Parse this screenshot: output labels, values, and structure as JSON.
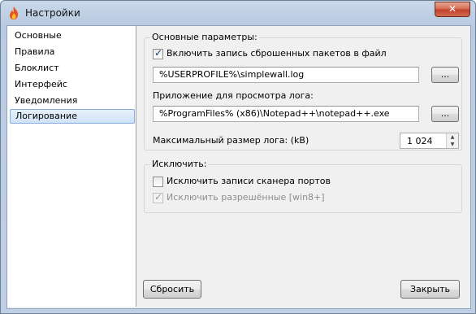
{
  "window": {
    "title": "Настройки",
    "close_label": "✕"
  },
  "sidebar": {
    "items": [
      {
        "label": "Основные"
      },
      {
        "label": "Правила"
      },
      {
        "label": "Блоклист"
      },
      {
        "label": "Интерфейс"
      },
      {
        "label": "Уведомления"
      },
      {
        "label": "Логирование",
        "selected": true
      }
    ]
  },
  "main": {
    "basic_group": {
      "title": "Основные параметры:",
      "enable_logging": {
        "label": "Включить запись сброшенных пакетов в файл",
        "checked": true
      },
      "log_path": "%USERPROFILE%\\simplewall.log",
      "browse_label": "...",
      "viewer_label": "Приложение для просмотра лога:",
      "viewer_path": "%ProgramFiles% (x86)\\Notepad++\\notepad++.exe",
      "max_size_label": "Максимальный размер лога: (kB)",
      "max_size_value": "1 024"
    },
    "exclude_group": {
      "title": "Исключить:",
      "exclude_port_scan": {
        "label": "Исключить записи сканера портов",
        "checked": false
      },
      "exclude_allowed": {
        "label": "Исключить разрешённые [win8+]",
        "checked": true,
        "disabled": true
      }
    }
  },
  "footer": {
    "reset_label": "Сбросить",
    "close_label": "Закрыть"
  }
}
